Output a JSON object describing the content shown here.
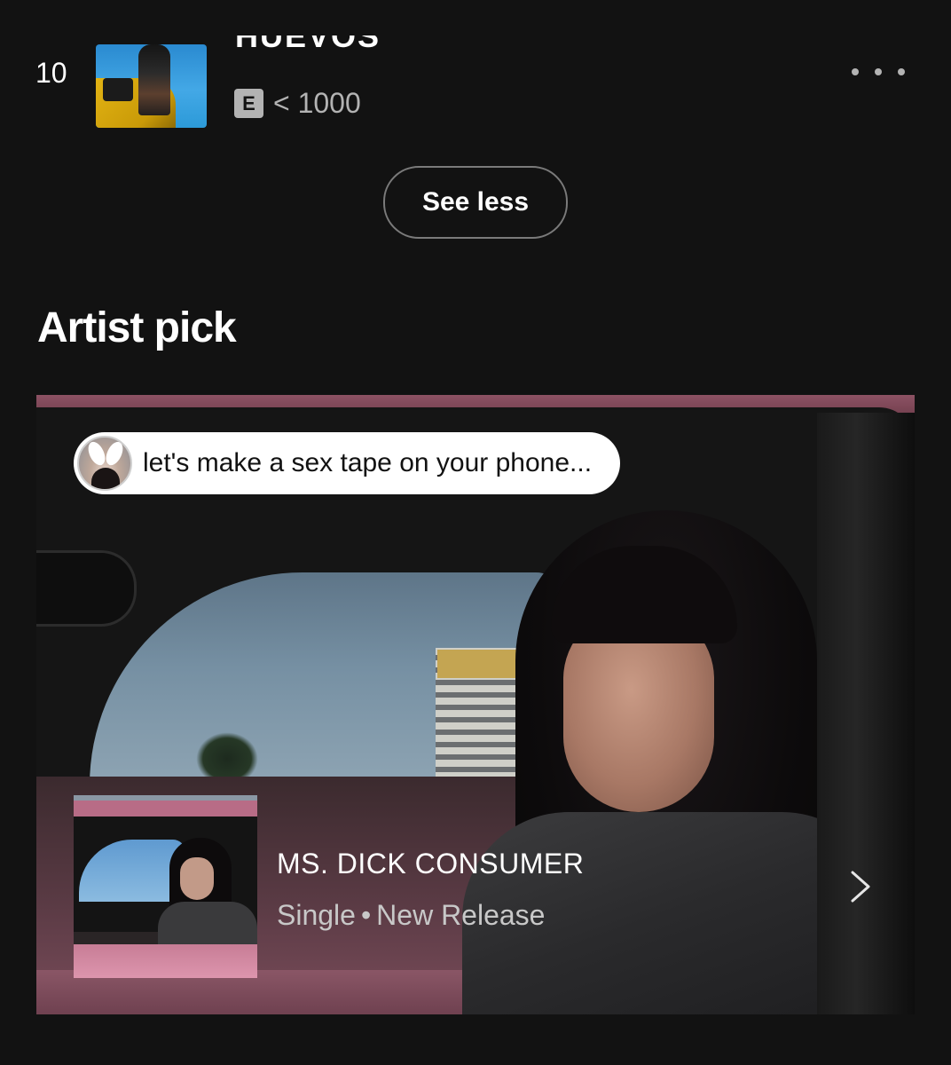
{
  "track": {
    "number": "10",
    "title": "HUEVOS",
    "explicit_badge": "E",
    "play_count": "< 1000",
    "more_icon": "more-horizontal-icon"
  },
  "see_less_label": "See less",
  "artist_pick": {
    "heading": "Artist pick",
    "quote": "let's make a sex tape on your phone...",
    "release": {
      "title": "MS. DICK CONSUMER",
      "type": "Single",
      "separator": "•",
      "tag": "New Release"
    },
    "chevron_icon": "chevron-right-icon"
  },
  "colors": {
    "background": "#121212",
    "text_primary": "#ffffff",
    "text_secondary": "#b3b3b3",
    "pill_border": "#7a7a7a"
  }
}
